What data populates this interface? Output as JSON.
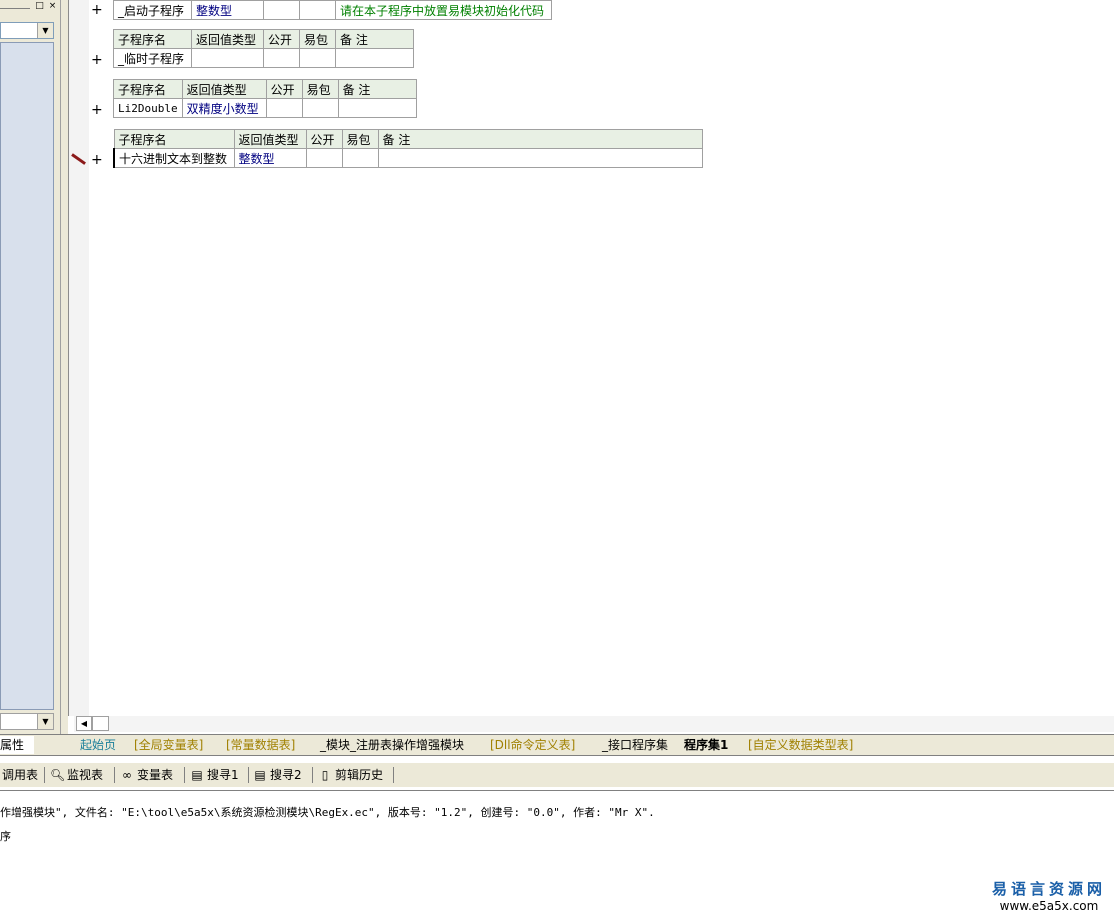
{
  "left_panel": {
    "tab_label": "属性",
    "pin_icon": "□",
    "close_icon": "×"
  },
  "procedures": [
    {
      "header": [
        "子程序名",
        "返回值类型",
        "公开",
        "易包",
        "备 注"
      ],
      "row": [
        "_启动子程序",
        "整数型",
        "",
        "",
        "请在本子程序中放置易模块初始化代码"
      ],
      "show_header": false
    },
    {
      "header": [
        "子程序名",
        "返回值类型",
        "公开",
        "易包",
        "备 注"
      ],
      "row": [
        "_临时子程序",
        "",
        "",
        "",
        ""
      ],
      "show_header": true
    },
    {
      "header": [
        "子程序名",
        "返回值类型",
        "公开",
        "易包",
        "备 注"
      ],
      "row": [
        "Li2Double",
        "双精度小数型",
        "",
        "",
        ""
      ],
      "show_header": true
    },
    {
      "header": [
        "子程序名",
        "返回值类型",
        "公开",
        "易包",
        "备 注"
      ],
      "row": [
        "十六进制文本到整数",
        "整数型",
        "",
        "",
        ""
      ],
      "show_header": true
    }
  ],
  "tabs": [
    {
      "label": "起始页"
    },
    {
      "label": "[全局变量表]"
    },
    {
      "label": "[常量数据表]"
    },
    {
      "label": "_模块_注册表操作增强模块"
    },
    {
      "label": "[Dll命令定义表]"
    },
    {
      "label": "_接口程序集"
    },
    {
      "label": "程序集1"
    },
    {
      "label": "[自定义数据类型表]"
    }
  ],
  "toolbar": {
    "items": [
      {
        "label": "调用表",
        "icon": ""
      },
      {
        "label": "监视表",
        "icon": "search-icon"
      },
      {
        "label": "变量表",
        "icon": "binoculars-icon"
      },
      {
        "label": "搜寻1",
        "icon": "find-icon"
      },
      {
        "label": "搜寻2",
        "icon": "find-icon"
      },
      {
        "label": "剪辑历史",
        "icon": "clipboard-icon"
      }
    ]
  },
  "output": {
    "line1": "作增强模块\", 文件名: \"E:\\tool\\e5a5x\\系统资源检测模块\\RegEx.ec\", 版本号: \"1.2\", 创建号: \"0.0\", 作者: \"Mr X\".",
    "line2": "序"
  },
  "watermark": {
    "name": "易语言资源网",
    "url": "www.e5a5x.com"
  },
  "colors": {
    "header_bg": "#e8f0e4",
    "type_blue": "#000080",
    "comment_green": "#008000",
    "tab_olive": "#a08000",
    "tab_teal": "#1a7f9a"
  }
}
